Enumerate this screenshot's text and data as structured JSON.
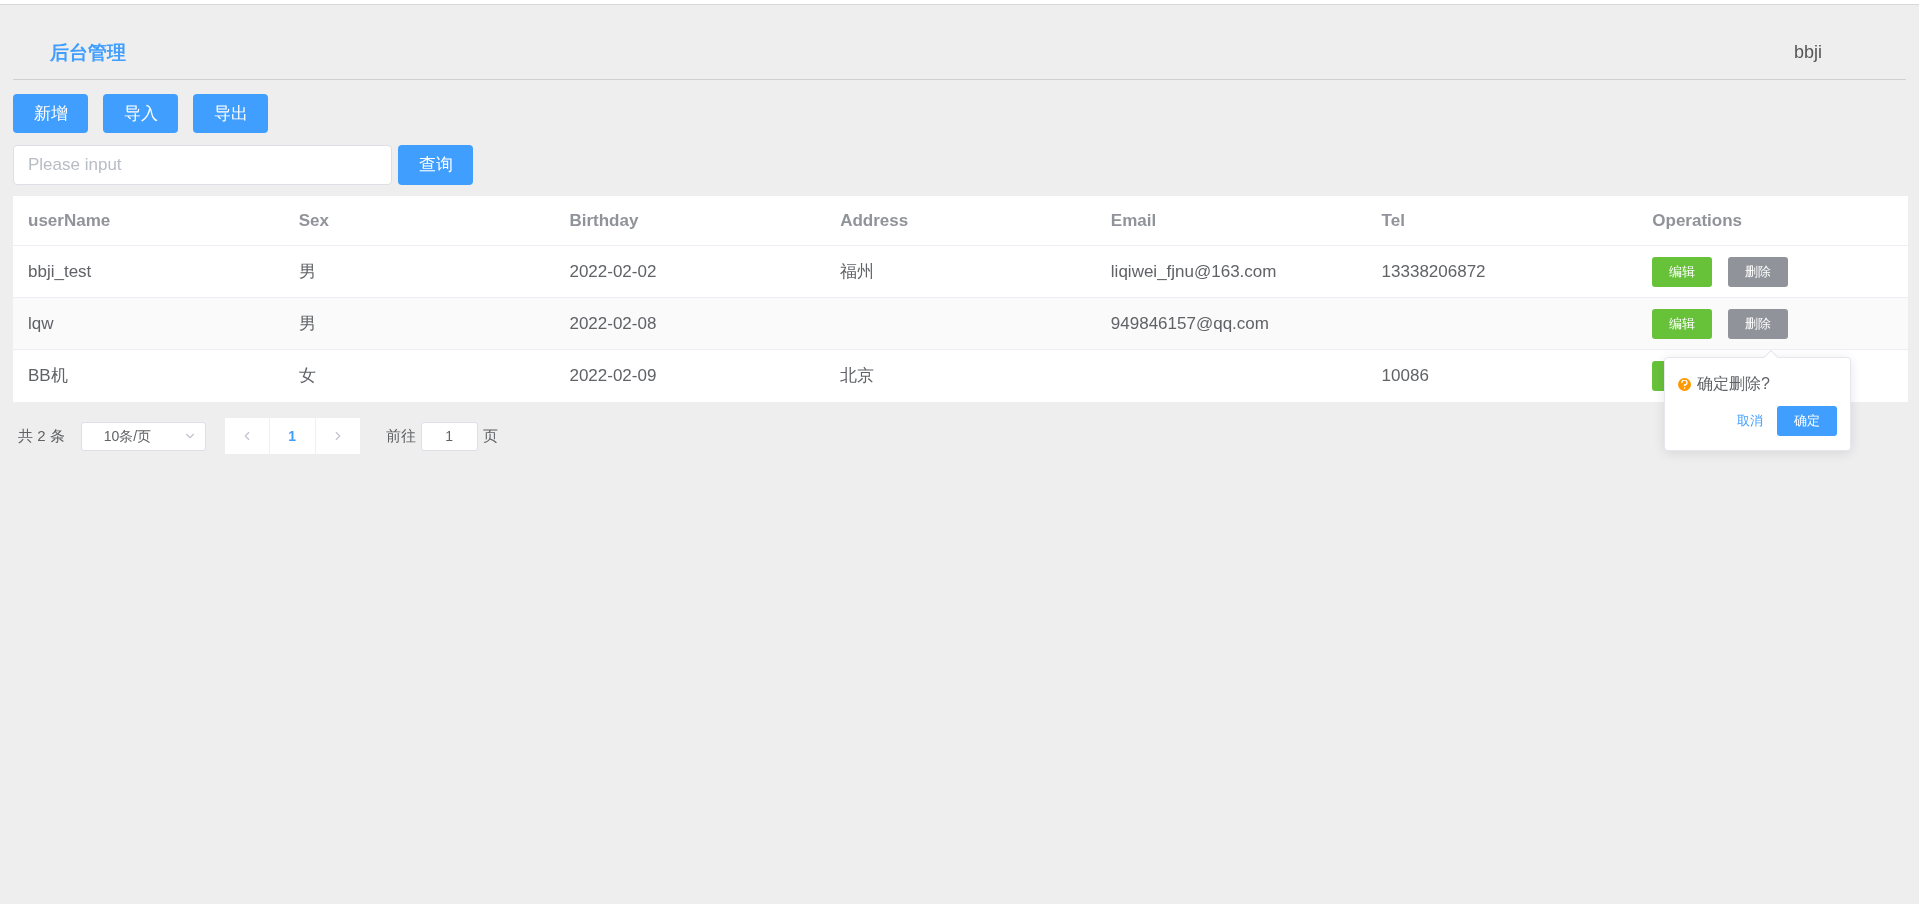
{
  "header": {
    "title": "后台管理",
    "user": "bbji"
  },
  "toolbar": {
    "buttons": [
      "新增",
      "导入",
      "导出"
    ]
  },
  "search": {
    "placeholder": "Please input",
    "button": "查询"
  },
  "table": {
    "columns": [
      "userName",
      "Sex",
      "Birthday",
      "Address",
      "Email",
      "Tel",
      "Operations"
    ],
    "rows": [
      {
        "cells": [
          "bbji_test",
          "男",
          "2022-02-02",
          "福州",
          "liqiwei_fjnu@163.com",
          "13338206872"
        ],
        "operations": [
          "编辑",
          "删除"
        ],
        "striped": false,
        "covered": false
      },
      {
        "cells": [
          "lqw",
          "男",
          "2022-02-08",
          "",
          "949846157@qq.com",
          ""
        ],
        "operations": [
          "编辑",
          "删除"
        ],
        "striped": true,
        "covered": false
      },
      {
        "cells": [
          "BB机",
          "女",
          "2022-02-09",
          "北京",
          "",
          "10086"
        ],
        "operations": [],
        "striped": false,
        "covered": true
      }
    ]
  },
  "popconfirm": {
    "message": "确定删除?",
    "cancel": "取消",
    "confirm": "确定"
  },
  "pagination": {
    "total": "共 2 条",
    "page_size": "10条/页",
    "pages": [
      {
        "label": "1",
        "selected": true
      }
    ],
    "goto_label": "前往",
    "goto_value": "1",
    "goto_suffix": "页"
  }
}
